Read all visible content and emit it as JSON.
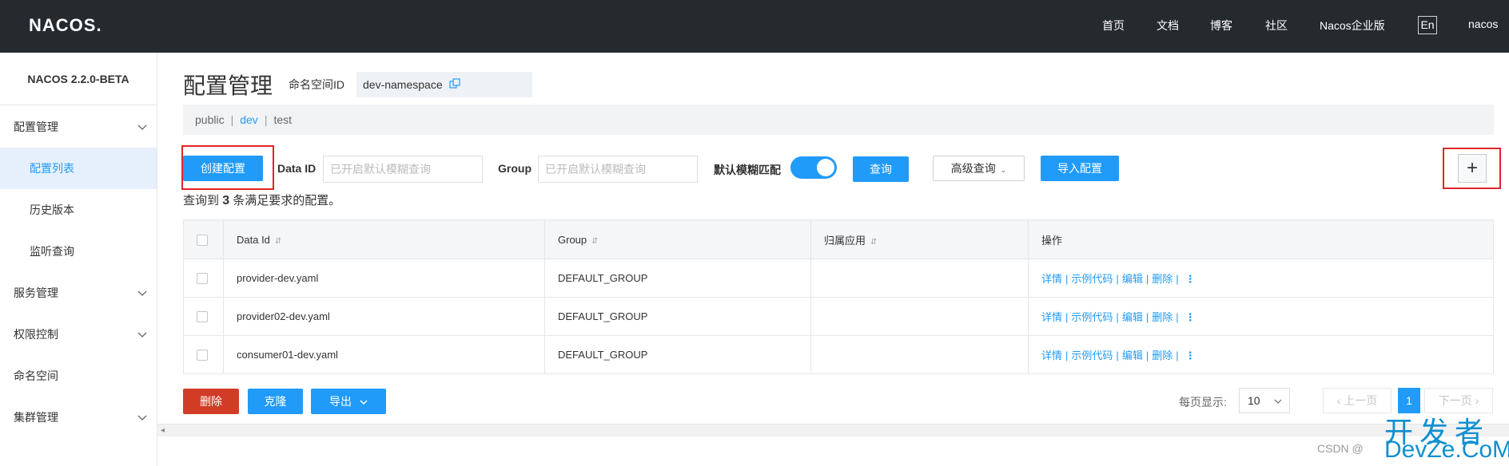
{
  "header": {
    "logo": "NACOS.",
    "nav": [
      "首页",
      "文档",
      "博客",
      "社区",
      "Nacos企业版"
    ],
    "lang": "En",
    "user": "nacos"
  },
  "sidebar": {
    "version": "NACOS 2.2.0-BETA",
    "items": [
      {
        "label": "配置管理"
      },
      {
        "label": "配置列表"
      },
      {
        "label": "历史版本"
      },
      {
        "label": "监听查询"
      },
      {
        "label": "服务管理"
      },
      {
        "label": "权限控制"
      },
      {
        "label": "命名空间"
      },
      {
        "label": "集群管理"
      }
    ]
  },
  "page": {
    "title": "配置管理",
    "ns_label": "命名空间ID",
    "ns_value": "dev-namespace",
    "namespaces": [
      "public",
      "dev",
      "test"
    ],
    "active_namespace": "dev"
  },
  "toolbar": {
    "create_label": "创建配置",
    "dataid_label": "Data ID",
    "dataid_placeholder": "已开启默认模糊查询",
    "group_label": "Group",
    "group_placeholder": "已开启默认模糊查询",
    "fuzzy_label": "默认模糊匹配",
    "search_label": "查询",
    "advanced_label": "高级查询",
    "import_label": "导入配置",
    "plus_label": "+"
  },
  "result": {
    "prefix": "查询到",
    "count": "3",
    "suffix": "条满足要求的配置。"
  },
  "table": {
    "headers": [
      "Data Id",
      "Group",
      "归属应用",
      "操作"
    ],
    "rows": [
      {
        "data_id": "provider-dev.yaml",
        "group": "DEFAULT_GROUP",
        "app": ""
      },
      {
        "data_id": "provider02-dev.yaml",
        "group": "DEFAULT_GROUP",
        "app": ""
      },
      {
        "data_id": "consumer01-dev.yaml",
        "group": "DEFAULT_GROUP",
        "app": ""
      }
    ],
    "ops": [
      "详情",
      "示例代码",
      "编辑",
      "删除"
    ]
  },
  "footer": {
    "delete_label": "删除",
    "clone_label": "克隆",
    "export_label": "导出",
    "page_size_label": "每页显示:",
    "page_size": "10",
    "prev_label": "上一页",
    "next_label": "下一页",
    "current_page": "1"
  },
  "watermark": {
    "site": "开发者",
    "domain": "DevZe.CoM",
    "csdn": "CSDN @"
  },
  "colors": {
    "primary": "#209bfa",
    "danger": "#d23c26",
    "header_bg": "#252a2f",
    "highlight": "#e0242b"
  }
}
